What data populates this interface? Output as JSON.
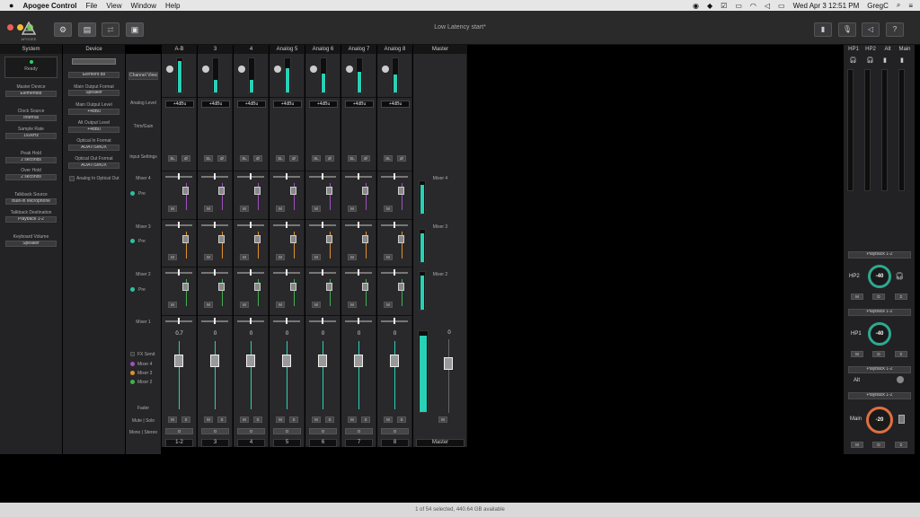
{
  "menubar": {
    "apple": "",
    "app": "Apogee Control",
    "items": [
      "File",
      "View",
      "Window",
      "Help"
    ],
    "clock": "Wed Apr 3  12:51 PM",
    "user": "GregC"
  },
  "window": {
    "title": "Low Latency start*"
  },
  "toolbar": {
    "logo_text": "APOGEE"
  },
  "system": {
    "header": "System",
    "status": "Ready",
    "master_device_label": "Master Device",
    "master_device": "Element88",
    "clock_source_label": "Clock Source",
    "clock_source": "Internal",
    "sample_rate_label": "Sample Rate",
    "sample_rate": "192kHz",
    "peak_hold_label": "Peak Hold",
    "peak_hold": "2 seconds",
    "over_hold_label": "Over Hold",
    "over_hold": "2 seconds",
    "talkback_source_label": "Talkback Source",
    "talkback_source": "Built-in Microphone",
    "talkback_dest_label": "Talkback Destination",
    "talkback_dest": "Playback 1-2",
    "keyboard_volume_label": "Keyboard Volume",
    "keyboard_volume": "Speaker"
  },
  "device": {
    "header": "Device",
    "name": "Element 88",
    "main_output_format_label": "Main Output Format",
    "main_output_format": "Speaker",
    "main_output_level_label": "Main Output Level",
    "main_output_level": "+4dBu",
    "alt_output_level_label": "Alt Output Level",
    "alt_output_level": "+4dBu",
    "optical_in_label": "Optical In Format",
    "optical_in": "ADAT/SMUX",
    "optical_out_label": "Optical Out Format",
    "optical_out": "ADAT/SMUX",
    "analog_in_optical_out": "Analog In Optical Out"
  },
  "row_labels": {
    "channel_view": "Channel View",
    "analog_level": "Analog Level",
    "trim_gain": "Trim/Gain",
    "input_settings": "Input Settings",
    "mixer4": "Mixer 4",
    "mixer3": "Mixer 3",
    "mixer2": "Mixer 2",
    "mixer1": "Mixer 1",
    "pre": "Pre",
    "fx_send": "FX Send",
    "fader": "Fader",
    "mute_solo": "Mute | Solo",
    "mono_stereo": "Mono | Stereo",
    "sel_mixer4": "Mixer 4",
    "sel_mixer3": "Mixer 3",
    "sel_mixer2": "Mixer 2"
  },
  "channels": [
    {
      "header": "A-B",
      "level": "+4dBu",
      "fader": "0.7",
      "num": "1-2",
      "meter": 0.92
    },
    {
      "header": "3",
      "level": "+4dBu",
      "fader": "0",
      "num": "3",
      "meter": 0.38
    },
    {
      "header": "4",
      "level": "+4dBu",
      "fader": "0",
      "num": "4",
      "meter": 0.36
    },
    {
      "header": "Analog 5",
      "level": "+4dBu",
      "fader": "0",
      "num": "5",
      "meter": 0.72
    },
    {
      "header": "Analog 6",
      "level": "+4dBu",
      "fader": "0",
      "num": "6",
      "meter": 0.55
    },
    {
      "header": "Analog 7",
      "level": "+4dBu",
      "fader": "0",
      "num": "7",
      "meter": 0.6
    },
    {
      "header": "Analog 8",
      "level": "+4dBu",
      "fader": "0",
      "num": "8",
      "meter": 0.52
    }
  ],
  "btn": {
    "sl": "SL",
    "phase": "Ø",
    "m": "M",
    "s": "S",
    "mono": "O",
    "d": "D",
    "sum": "Σ"
  },
  "master": {
    "header": "Master",
    "mixer4": "Mixer 4",
    "mixer3": "Mixer 3",
    "mixer2": "Mixer 2",
    "fader": "0",
    "num": "Master",
    "meter": 0.95
  },
  "outputs": {
    "headers": [
      "HP1",
      "HP2",
      "Alt",
      "Main"
    ],
    "hp2_label": "HP2",
    "hp2_source": "Playback 1-2",
    "hp2_value": "-40",
    "hp1_label": "HP1",
    "hp1_source": "Playback 1-2",
    "hp1_value": "-40",
    "alt_label": "Alt",
    "alt_source": "Playback 1-2",
    "main_label": "Main",
    "main_source": "Playback 1-2",
    "main_value": "-20"
  },
  "status": {
    "text": "1 of 54 selected, 440.64 GB available"
  },
  "colors": {
    "meter": "#28d0b6",
    "knob_ring": "#2fa891",
    "main_ring": "#e07040",
    "pre_led": "#2fc0a0"
  }
}
